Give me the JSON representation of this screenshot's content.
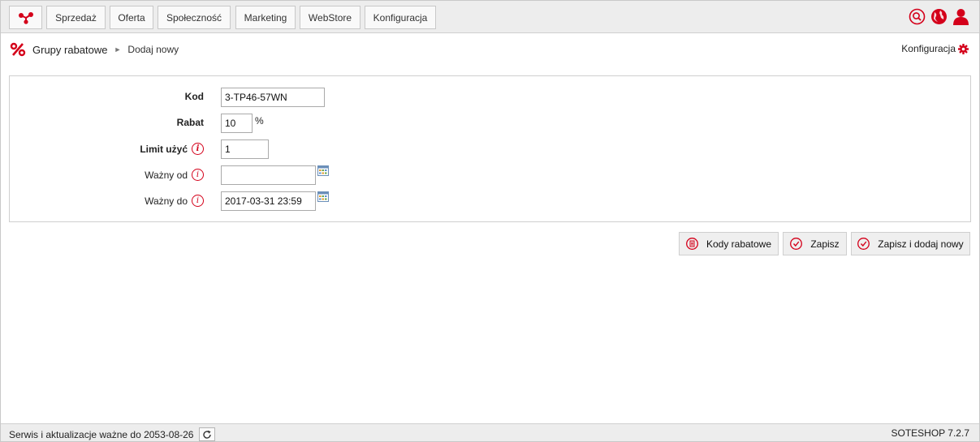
{
  "topbar": {
    "home_icon": "network-nodes-icon",
    "menu": [
      "Sprzedaż",
      "Oferta",
      "Społeczność",
      "Marketing",
      "WebStore",
      "Konfiguracja"
    ],
    "icons": [
      "search-icon",
      "globe-icon",
      "user-icon"
    ]
  },
  "breadcrumb": {
    "section": "Grupy rabatowe",
    "separator": "►",
    "current": "Dodaj nowy"
  },
  "config_link": "Konfiguracja",
  "form": {
    "code": {
      "label": "Kod",
      "value": "3-TP46-57WN"
    },
    "discount": {
      "label": "Rabat",
      "value": "10",
      "unit": "%"
    },
    "limit": {
      "label": "Limit użyć",
      "value": "1"
    },
    "valid_from": {
      "label": "Ważny od",
      "value": ""
    },
    "valid_to": {
      "label": "Ważny do",
      "value": "2017-03-31 23:59"
    }
  },
  "actions": {
    "codes": "Kody rabatowe",
    "save": "Zapisz",
    "save_add": "Zapisz i dodaj nowy"
  },
  "footer": {
    "service": "Serwis i aktualizacje ważne do 2053-08-26",
    "version": "SOTESHOP 7.2.7"
  },
  "colors": {
    "accent": "#d4001a",
    "bar": "#ededed"
  }
}
